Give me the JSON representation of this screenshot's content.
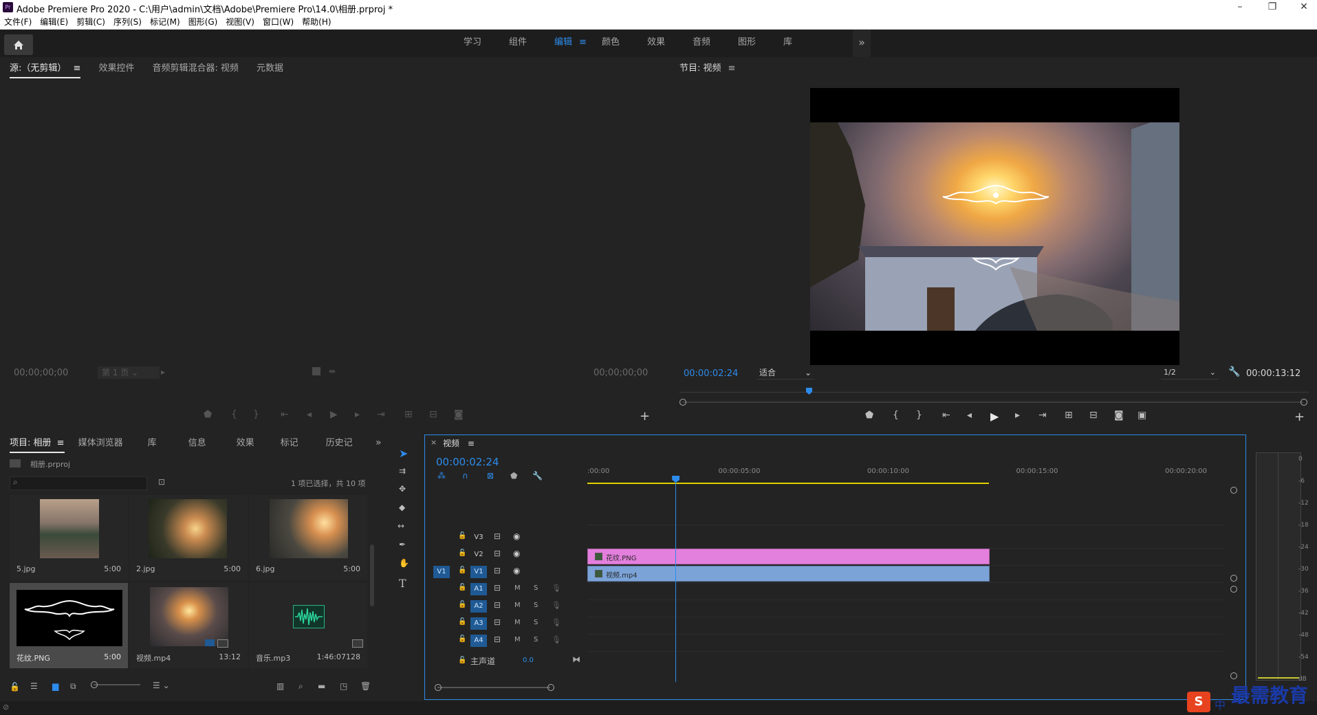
{
  "app": {
    "window_title": "Adobe Premiere Pro 2020 - C:\\用户\\admin\\文档\\Adobe\\Premiere Pro\\14.0\\相册.prproj *",
    "menu": [
      "文件(F)",
      "编辑(E)",
      "剪辑(C)",
      "序列(S)",
      "标记(M)",
      "图形(G)",
      "视图(V)",
      "窗口(W)",
      "帮助(H)"
    ],
    "workspaces": [
      "学习",
      "组件",
      "编辑",
      "颜色",
      "效果",
      "音频",
      "图形",
      "库"
    ],
    "active_workspace": "编辑",
    "accent_color": "#2d8ceb"
  },
  "source_panel": {
    "tabs": [
      "源:（无剪辑）",
      "效果控件",
      "音频剪辑混合器: 视频",
      "元数据"
    ],
    "timecode_left": "00;00;00;00",
    "page_select": "第 1 页",
    "timecode_right": "00;00;00;00"
  },
  "program_panel": {
    "title": "节目: 视频",
    "current_time": "00:00:02:24",
    "fit": "适合",
    "resolution": "1/2",
    "duration": "00:00:13:12"
  },
  "project_panel": {
    "tabs": [
      "项目: 相册",
      "媒体浏览器",
      "库",
      "信息",
      "效果",
      "标记",
      "历史记"
    ],
    "project_file": "相册.prproj",
    "selection_status": "1 项已选择，共 10 项",
    "items": [
      {
        "name": "5.jpg",
        "duration": "5:00"
      },
      {
        "name": "2.jpg",
        "duration": "5:00"
      },
      {
        "name": "6.jpg",
        "duration": "5:00"
      },
      {
        "name": "花纹.PNG",
        "duration": "5:00"
      },
      {
        "name": "视频.mp4",
        "duration": "13:12"
      },
      {
        "name": "音乐.mp3",
        "duration": "1:46:07128"
      }
    ]
  },
  "timeline": {
    "sequence_name": "视频",
    "current_time": "00:00:02:24",
    "ruler_ticks": [
      ":00:00",
      "00:00:05:00",
      "00:00:10:00",
      "00:00:15:00",
      "00:00:20:00"
    ],
    "video_tracks": [
      "V3",
      "V2",
      "V1"
    ],
    "audio_tracks": [
      "A1",
      "A2",
      "A3",
      "A4"
    ],
    "source_patch": "V1",
    "master_label": "主声道",
    "master_value": "0.0",
    "clips": [
      {
        "name": "花纹.PNG",
        "track": "V2",
        "color": "#e37fdc",
        "start_s": 0,
        "end_s": 13.5
      },
      {
        "name": "视频.mp4",
        "track": "V1",
        "color": "#7ba3d8",
        "start_s": 0,
        "end_s": 13.5
      }
    ],
    "playhead_s": 2.96,
    "mute_label": "M",
    "solo_label": "S"
  },
  "audio_meter": {
    "labels": [
      "0",
      "-6",
      "-12",
      "-18",
      "-24",
      "-30",
      "-36",
      "-42",
      "-48",
      "-54",
      "dB"
    ]
  },
  "watermark": {
    "text": "最需教育",
    "ime": "中"
  }
}
